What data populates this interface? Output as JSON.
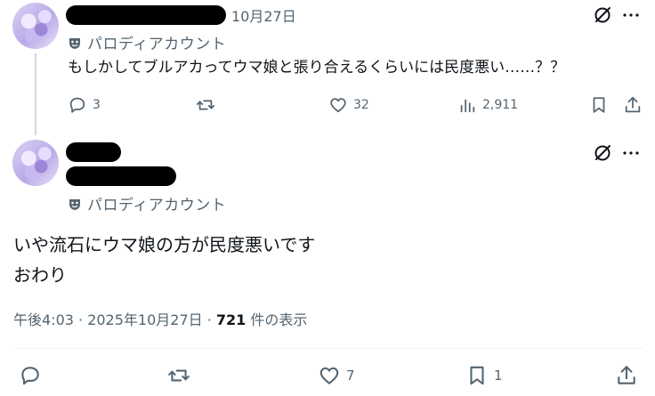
{
  "tweet1": {
    "date": "10月27日",
    "account_label": "パロディアカウント",
    "text": "もしかしてブルアカってウマ娘と張り合えるくらいには民度悪い……？？",
    "replies": "3",
    "likes": "32",
    "views": "2,911"
  },
  "tweet2": {
    "account_label": "パロディアカウント",
    "text_line1": "いや流石にウマ娘の方が民度悪いです",
    "text_line2": "おわり",
    "time": "午後4:03 · 2025年10月27日 · ",
    "views_count": "721",
    "views_suffix": " 件の表示",
    "likes": "7",
    "bookmarks": "1"
  }
}
